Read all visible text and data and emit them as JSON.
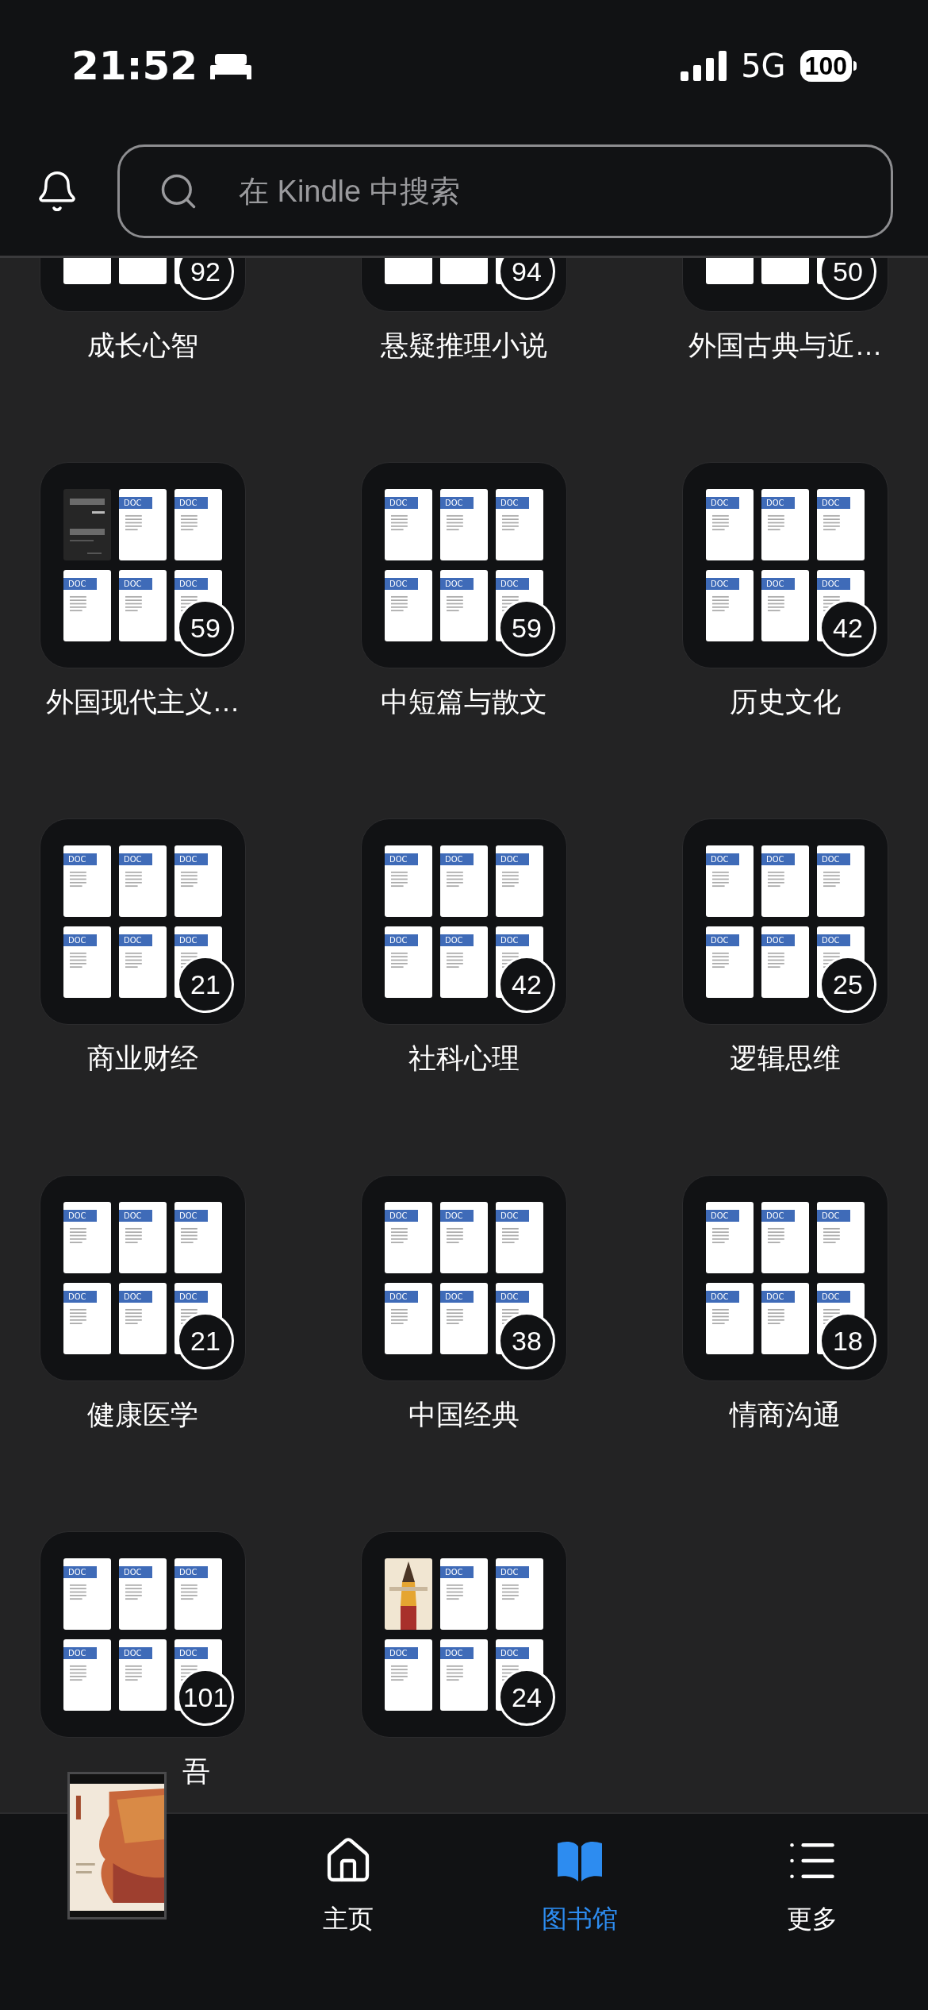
{
  "status_bar": {
    "time": "21:52",
    "network": "5G",
    "battery": "100"
  },
  "search": {
    "placeholder": "在 Kindle 中搜索"
  },
  "collections": [
    {
      "title": "成长心智",
      "count": "92",
      "slots": [
        {
          "kind": "blank"
        },
        {
          "kind": "blank"
        },
        {
          "kind": "blank"
        }
      ]
    },
    {
      "title": "悬疑推理小说",
      "count": "94",
      "slots": [
        {
          "kind": "blank"
        },
        {
          "kind": "blank"
        },
        {
          "kind": "blank"
        }
      ]
    },
    {
      "title": "外国古典与近…",
      "count": "50",
      "slots": [
        {
          "kind": "blank"
        },
        {
          "kind": "blank"
        },
        {
          "kind": "blank"
        }
      ]
    },
    {
      "title": "外国现代主义…",
      "count": "59",
      "slots": [
        {
          "kind": "cover"
        },
        {
          "kind": "doc",
          "label": "DOC"
        },
        {
          "kind": "doc",
          "label": "DOC"
        },
        {
          "kind": "doc",
          "label": "DOC"
        },
        {
          "kind": "doc",
          "label": "DOC"
        },
        {
          "kind": "doc",
          "label": "DOC"
        }
      ]
    },
    {
      "title": "中短篇与散文",
      "count": "59",
      "slots": [
        {
          "kind": "doc",
          "label": "DOC"
        },
        {
          "kind": "doc",
          "label": "DOC"
        },
        {
          "kind": "doc",
          "label": "DOC"
        },
        {
          "kind": "doc",
          "label": "DOC"
        },
        {
          "kind": "doc",
          "label": "DOC"
        },
        {
          "kind": "doc",
          "label": "DOC"
        }
      ]
    },
    {
      "title": "历史文化",
      "count": "42",
      "slots": [
        {
          "kind": "doc",
          "label": "DOC"
        },
        {
          "kind": "doc",
          "label": "DOC"
        },
        {
          "kind": "doc",
          "label": "DOC"
        },
        {
          "kind": "doc",
          "label": "DOC"
        },
        {
          "kind": "doc",
          "label": "DOC"
        },
        {
          "kind": "doc",
          "label": "DOC"
        }
      ]
    },
    {
      "title": "商业财经",
      "count": "21",
      "slots": [
        {
          "kind": "doc",
          "label": "DOC"
        },
        {
          "kind": "doc",
          "label": "DOC"
        },
        {
          "kind": "doc",
          "label": "DOC"
        },
        {
          "kind": "doc",
          "label": "DOC"
        },
        {
          "kind": "doc",
          "label": "DOC"
        },
        {
          "kind": "doc",
          "label": "DOC"
        }
      ]
    },
    {
      "title": "社科心理",
      "count": "42",
      "slots": [
        {
          "kind": "doc",
          "label": "DOC"
        },
        {
          "kind": "doc",
          "label": "DOC"
        },
        {
          "kind": "doc",
          "label": "DOC"
        },
        {
          "kind": "doc",
          "label": "DOC"
        },
        {
          "kind": "doc",
          "label": "DOC"
        },
        {
          "kind": "doc",
          "label": "DOC"
        }
      ]
    },
    {
      "title": "逻辑思维",
      "count": "25",
      "slots": [
        {
          "kind": "doc",
          "label": "DOC"
        },
        {
          "kind": "doc",
          "label": "DOC"
        },
        {
          "kind": "doc",
          "label": "DOC"
        },
        {
          "kind": "doc",
          "label": "DOC"
        },
        {
          "kind": "doc",
          "label": "DOC"
        },
        {
          "kind": "doc",
          "label": "DOC"
        }
      ]
    },
    {
      "title": "健康医学",
      "count": "21",
      "slots": [
        {
          "kind": "doc",
          "label": "DOC"
        },
        {
          "kind": "doc",
          "label": "DOC"
        },
        {
          "kind": "doc",
          "label": "DOC"
        },
        {
          "kind": "doc",
          "label": "DOC"
        },
        {
          "kind": "doc",
          "label": "DOC"
        },
        {
          "kind": "doc",
          "label": "DOC"
        }
      ]
    },
    {
      "title": "中国经典",
      "count": "38",
      "slots": [
        {
          "kind": "doc",
          "label": "DOC"
        },
        {
          "kind": "doc",
          "label": "DOC"
        },
        {
          "kind": "doc",
          "label": "DOC"
        },
        {
          "kind": "doc",
          "label": "DOC"
        },
        {
          "kind": "doc",
          "label": "DOC"
        },
        {
          "kind": "doc",
          "label": "DOC"
        }
      ]
    },
    {
      "title": "情商沟通",
      "count": "18",
      "slots": [
        {
          "kind": "doc",
          "label": "DOC"
        },
        {
          "kind": "doc",
          "label": "DOC"
        },
        {
          "kind": "doc",
          "label": "DOC"
        },
        {
          "kind": "doc",
          "label": "DOC"
        },
        {
          "kind": "doc",
          "label": "DOC"
        },
        {
          "kind": "doc",
          "label": "DOC"
        }
      ]
    },
    {
      "title": "吾",
      "count": "101",
      "slots": [
        {
          "kind": "doc",
          "label": "DOC"
        },
        {
          "kind": "doc",
          "label": "DOC"
        },
        {
          "kind": "doc",
          "label": "DOC"
        },
        {
          "kind": "doc",
          "label": "DOC"
        },
        {
          "kind": "doc",
          "label": "DOC"
        },
        {
          "kind": "doc",
          "label": "DOC"
        }
      ]
    },
    {
      "count": "24",
      "slots": [
        {
          "kind": "cover"
        },
        {
          "kind": "doc",
          "label": "DOC"
        },
        {
          "kind": "doc",
          "label": "DOC"
        },
        {
          "kind": "doc",
          "label": "DOC"
        },
        {
          "kind": "doc",
          "label": "DOC"
        },
        {
          "kind": "doc",
          "label": "DOC"
        }
      ]
    }
  ],
  "bottom_nav": [
    {
      "label": "主页",
      "selected": false
    },
    {
      "label": "图书馆",
      "selected": true
    },
    {
      "label": "更多",
      "selected": false
    }
  ]
}
